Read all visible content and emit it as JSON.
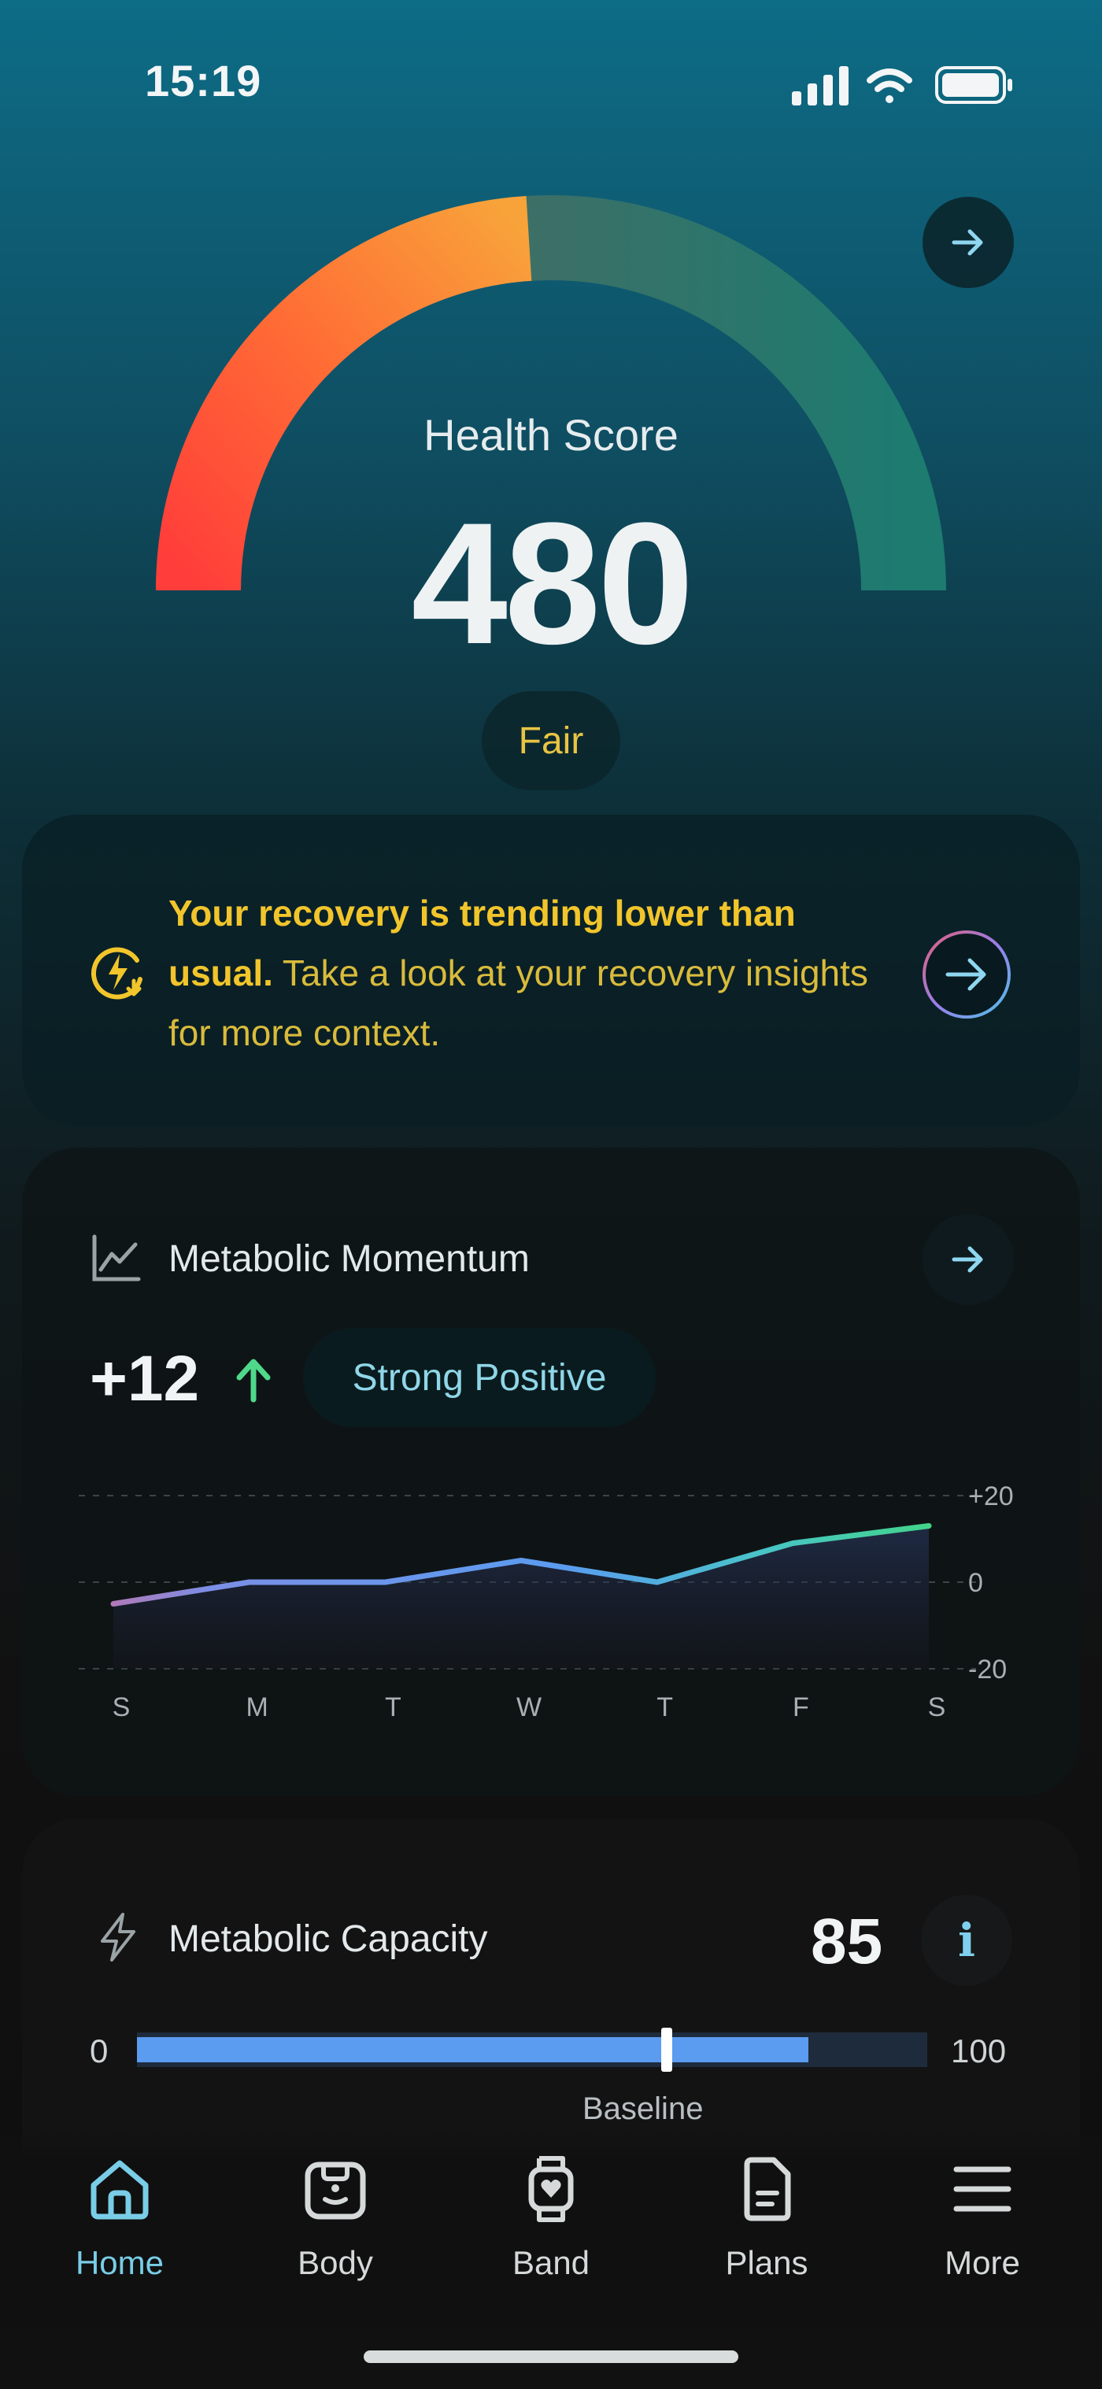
{
  "status_bar": {
    "time": "15:19"
  },
  "health_score": {
    "label": "Health Score",
    "value": "480",
    "rating": "Fair",
    "score_fraction": 0.48
  },
  "recovery_alert": {
    "headline": "Your recovery is trending lower than usual.",
    "body": " Take a look at your recovery insights for more context."
  },
  "metabolic_momentum": {
    "title": "Metabolic Momentum",
    "value": "+12",
    "status": "Strong Positive"
  },
  "chart_data": {
    "type": "area",
    "categories": [
      "S",
      "M",
      "T",
      "W",
      "T",
      "F",
      "S"
    ],
    "series": [
      {
        "values": [
          -5,
          0,
          0,
          5,
          0,
          9,
          13
        ]
      }
    ],
    "ylim": [
      -20,
      20
    ],
    "y_ticks": [
      "+20",
      "0",
      "-20"
    ],
    "grid": true,
    "title": "",
    "xlabel": "",
    "ylabel": ""
  },
  "metabolic_capacity": {
    "title": "Metabolic Capacity",
    "value": "85",
    "info_label": "i",
    "min_label": "0",
    "max_label": "100",
    "fill_percent": 85,
    "baseline_percent": 67,
    "baseline_label": "Baseline"
  },
  "nav": {
    "items": [
      {
        "label": "Home",
        "icon": "home-icon",
        "active": true
      },
      {
        "label": "Body",
        "icon": "body-icon",
        "active": false
      },
      {
        "label": "Band",
        "icon": "band-icon",
        "active": false
      },
      {
        "label": "Plans",
        "icon": "plans-icon",
        "active": false
      },
      {
        "label": "More",
        "icon": "menu-icon",
        "active": false
      }
    ]
  },
  "colors": {
    "accent": "#79cde6",
    "warning": "#f1c52b",
    "positive": "#4fd88a",
    "bar": "#5b9bf0"
  }
}
